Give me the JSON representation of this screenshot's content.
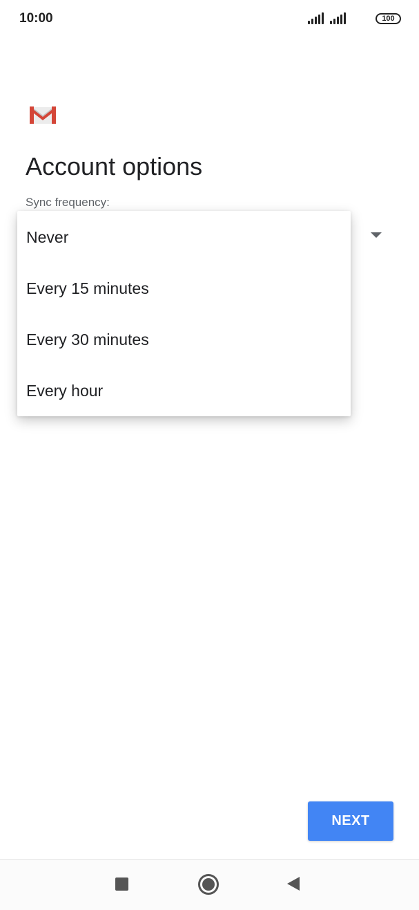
{
  "status_bar": {
    "time": "10:00",
    "battery": "100"
  },
  "header": {
    "logo_icon": "gmail-logo",
    "title": "Account options"
  },
  "sync": {
    "label": "Sync frequency:",
    "options": [
      "Never",
      "Every 15 minutes",
      "Every 30 minutes",
      "Every hour"
    ]
  },
  "actions": {
    "next_label": "NEXT"
  },
  "nav": {
    "recent_icon": "square-icon",
    "home_icon": "circle-icon",
    "back_icon": "triangle-back-icon"
  },
  "colors": {
    "accent": "#4285f4",
    "gmail_red": "#d44638"
  }
}
